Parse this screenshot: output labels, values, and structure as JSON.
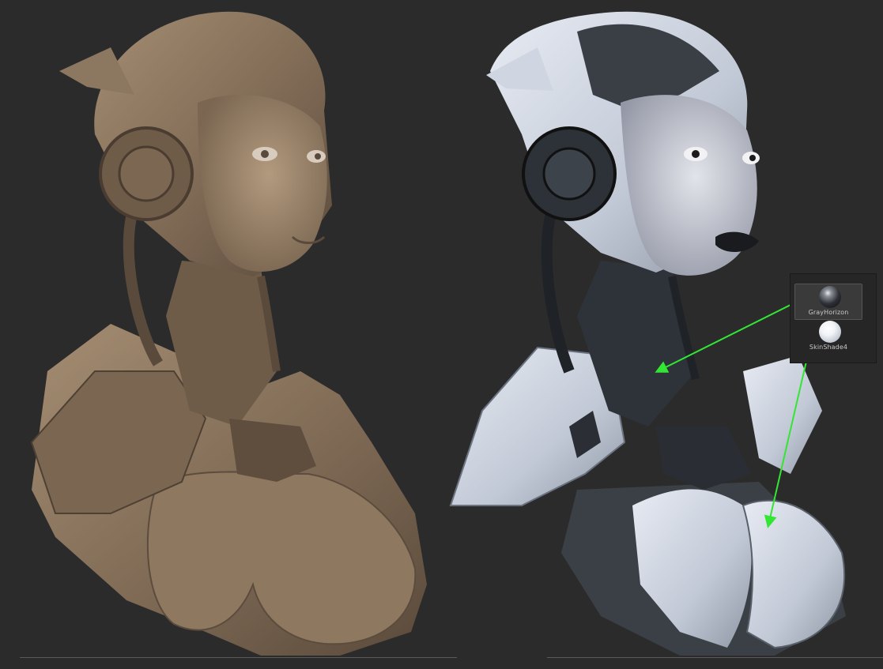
{
  "materials": [
    {
      "name": "GrayHorizon",
      "selected": true,
      "icon": "matcap-ball-dark-icon"
    },
    {
      "name": "SkinShade4",
      "selected": false,
      "icon": "matcap-ball-white-icon"
    }
  ],
  "colors": {
    "background": "#2b2b2b",
    "clay": "#8a7660",
    "light_material": "#c9d0dc",
    "dark_material": "#2f343b",
    "arrow": "#33e633"
  }
}
